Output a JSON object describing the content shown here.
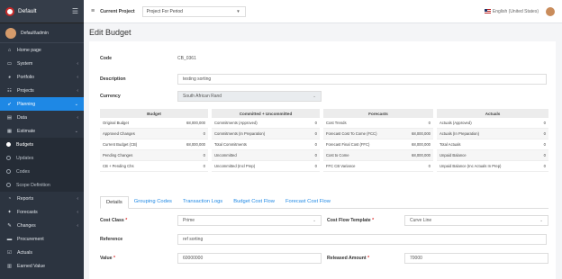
{
  "brand": {
    "name": "Default"
  },
  "user": {
    "name": "Default\\admin"
  },
  "sidebar": {
    "items": [
      {
        "label": "Home page",
        "icon": "home-icon"
      },
      {
        "label": "System",
        "icon": "monitor-icon"
      },
      {
        "label": "Portfolio",
        "icon": "pie-icon"
      },
      {
        "label": "Projects",
        "icon": "list-icon"
      },
      {
        "label": "Planning",
        "icon": "rocket-icon"
      },
      {
        "label": "Data",
        "icon": "database-icon"
      },
      {
        "label": "Estimate",
        "icon": "calculator-icon"
      },
      {
        "label": "Budgets",
        "icon": "dot"
      },
      {
        "label": "Updates",
        "icon": "dot"
      },
      {
        "label": "Codes",
        "icon": "dot"
      },
      {
        "label": "Scope Definition",
        "icon": "dot"
      },
      {
        "label": "Reports",
        "icon": "chart-icon"
      },
      {
        "label": "Forecasts",
        "icon": "forecast-icon"
      },
      {
        "label": "Changes",
        "icon": "edit-icon"
      },
      {
        "label": "Procurement",
        "icon": "folder-icon"
      },
      {
        "label": "Actuals",
        "icon": "check-icon"
      },
      {
        "label": "Earned Value",
        "icon": "table-icon"
      }
    ]
  },
  "topbar": {
    "current_project_label": "Current Project",
    "current_project_value": "Project For Period",
    "language": "English (United States)"
  },
  "page": {
    "title": "Edit Budget"
  },
  "form": {
    "code_label": "Code",
    "code_value": "CB_0361",
    "description_label": "Description",
    "description_value": "testing sorting",
    "currency_label": "Currency",
    "currency_value": "South African Rand",
    "cost_class_label": "Cost Class",
    "cost_class_value": "Prime",
    "cost_flow_label": "Cost Flow Template",
    "cost_flow_value": "Curve Line",
    "reference_label": "Reference",
    "reference_value": "ref sorting",
    "value_label": "Value",
    "value_value": "60000000",
    "released_label": "Released Amount",
    "released_value": "70000"
  },
  "summary": {
    "budget": {
      "title": "Budget",
      "rows": [
        {
          "k": "Original Budget",
          "v": "68,000,000"
        },
        {
          "k": "Approved Changes",
          "v": "0"
        },
        {
          "k": "Current Budget (CB)",
          "v": "68,000,000"
        },
        {
          "k": "Pending Changes",
          "v": "0"
        },
        {
          "k": "CB + Pending Chs",
          "v": "0"
        }
      ]
    },
    "committed": {
      "title": "Committed + Uncommitted",
      "rows": [
        {
          "k": "Commitments (Approved)",
          "v": "0"
        },
        {
          "k": "Commitments (In Preparation)",
          "v": "0"
        },
        {
          "k": "Total Commitments",
          "v": "0"
        },
        {
          "k": "Uncommitted",
          "v": "0"
        },
        {
          "k": "Uncommitted (Incl Prep)",
          "v": "0"
        }
      ]
    },
    "forecasts": {
      "title": "Forecasts",
      "rows": [
        {
          "k": "Cost Trends",
          "v": "0"
        },
        {
          "k": "Forecast Cost To Come (FCC)",
          "v": "68,000,000"
        },
        {
          "k": "Forecast Final Cost (FFC)",
          "v": "68,000,000"
        },
        {
          "k": "Cost to Come",
          "v": "68,000,000"
        },
        {
          "k": "FFC CB Variance",
          "v": "0"
        }
      ]
    },
    "actuals": {
      "title": "Actuals",
      "rows": [
        {
          "k": "Actuals (Approved)",
          "v": "0"
        },
        {
          "k": "Actuals (In Preparation)",
          "v": "0"
        },
        {
          "k": "Total Actuals",
          "v": "0"
        },
        {
          "k": "Unpaid Balance",
          "v": "0"
        },
        {
          "k": "Unpaid Balance (Inc Actuals In Prep)",
          "v": "0"
        }
      ]
    }
  },
  "tabs": [
    "Details",
    "Grouping Codes",
    "Transaction Logs",
    "Budget Cost Flow",
    "Forecast Cost Flow"
  ],
  "colors": {
    "accent": "#1e88e5",
    "sidebar": "#2c3440"
  }
}
